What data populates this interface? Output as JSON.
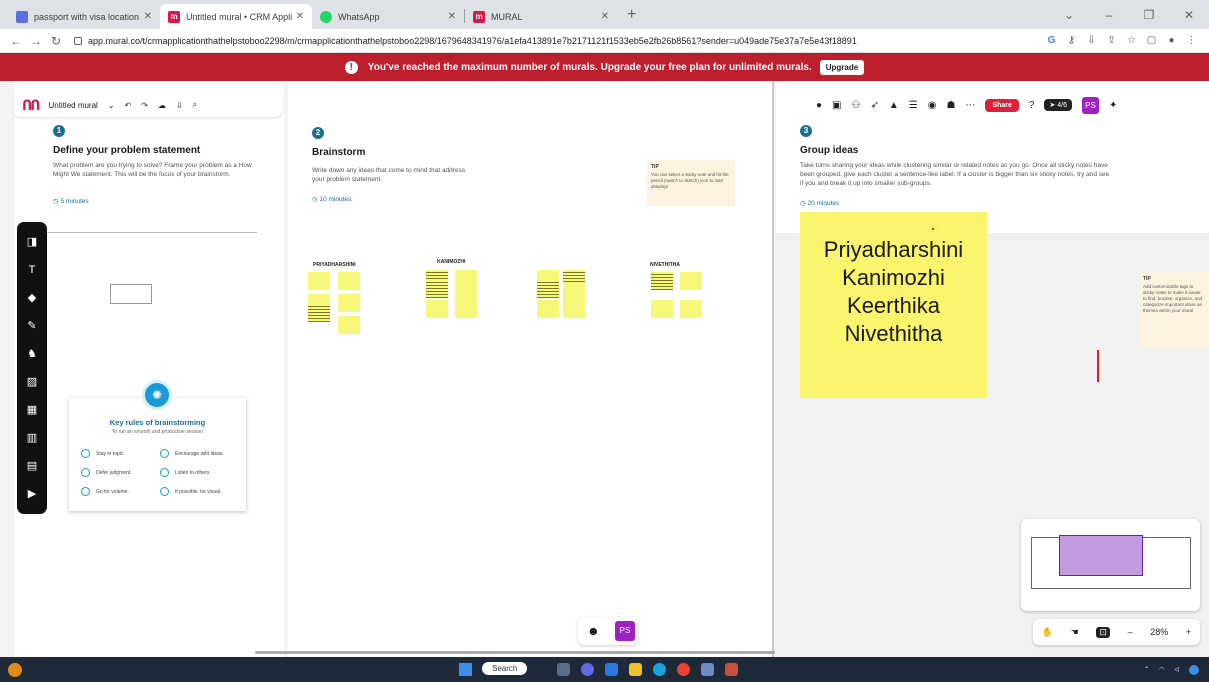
{
  "browser": {
    "tabs": [
      {
        "title": "passport with visa location | Sale",
        "icon_color": "#5b6fe0",
        "active": false
      },
      {
        "title": "Untitled mural • CRM Application",
        "icon_color": "#d6194a",
        "active": true
      },
      {
        "title": "WhatsApp",
        "icon_color": "#25d366",
        "active": false
      },
      {
        "title": "MURAL",
        "icon_color": "#d6194a",
        "active": false
      }
    ],
    "url": "app.mural.co/t/crmapplicationthathelpstoboo2298/m/crmapplicationthathelpstoboo2298/1679648341976/a1efa413891e7b2171121f1533eb5e2fb26b8561?sender=u049ade75e37a7e5e43f18891",
    "new_tab": "+"
  },
  "banner": {
    "message": "You've reached the maximum number of murals. Upgrade your free plan for unlimited murals.",
    "button": "Upgrade",
    "color": "#bd1f2d"
  },
  "toolbar": {
    "mural_name": "Untitled mural",
    "share_label": "Share",
    "participants": "4/6",
    "avatar": "PS"
  },
  "steps": [
    {
      "num": "1",
      "title": "Define your problem statement",
      "desc": "What problem are you trying to solve? Frame your problem as a How Might We statement. This will be the focus of your brainstorm.",
      "time": "5 minutes"
    },
    {
      "num": "2",
      "title": "Brainstorm",
      "desc": "Write down any ideas that come to mind that address your problem statement.",
      "time": "10 minutes"
    },
    {
      "num": "3",
      "title": "Group ideas",
      "desc": "Take turns sharing your ideas while clustering similar or related notes as you go. Once all sticky notes have been grouped, give each cluster a sentence-like label. If a cluster is bigger than six sticky notes, try and see if you and break it up into smaller sub-groups.",
      "time": "20 minutes"
    }
  ],
  "brainstorm_columns": [
    "PRIYADHARSHINI",
    "KANIMOZHI",
    "NIVETHITHA"
  ],
  "tips": [
    {
      "title": "TIP",
      "text": "You can select a sticky note and hit the pencil (switch to sketch) icon to start drawing!"
    },
    {
      "title": "TIP",
      "text": "Add customizable tags to sticky notes to make it easier to find, browse, organize, and categorize important ideas as themes within your mural."
    }
  ],
  "key_rules": {
    "title": "Key rules of brainstorming",
    "subtitle": "To run an smooth and productive session",
    "rules": [
      "Stay in topic.",
      "Encourage wild ideas.",
      "Defer judgment.",
      "Listen to others.",
      "Go for volume.",
      "If possible, be visual."
    ]
  },
  "group_sticky": {
    "names": [
      "Priyadharshini",
      "Kanimozhi",
      "Keerthika",
      "Nivethitha"
    ]
  },
  "zoom": {
    "level": "28%",
    "minus": "–",
    "plus": "+"
  },
  "bottom_avatar": "PS",
  "taskbar": {
    "search": "Search"
  }
}
